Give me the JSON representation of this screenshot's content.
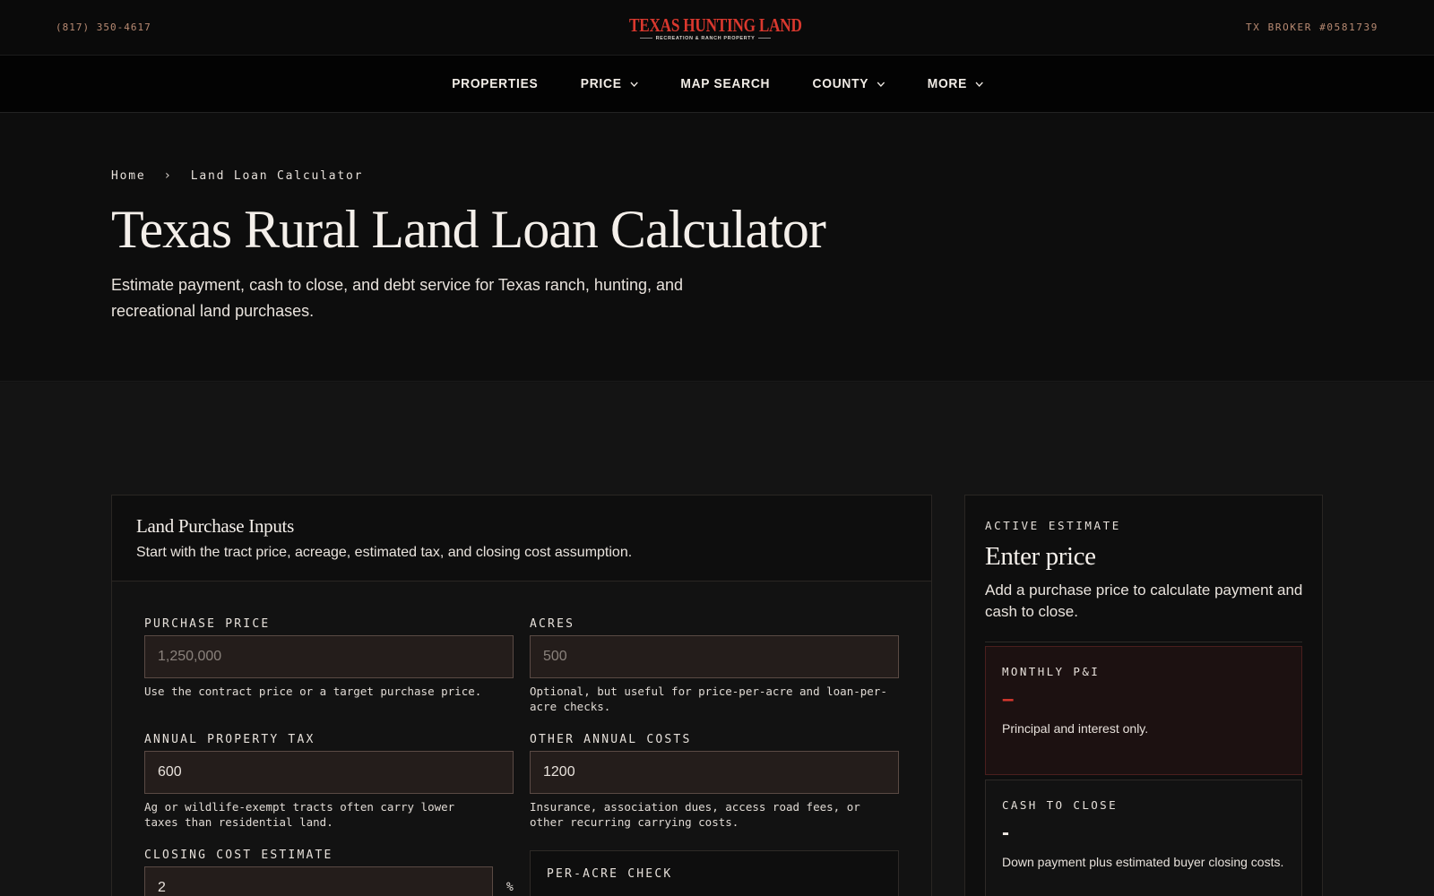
{
  "header": {
    "phone": "(817) 350-4617",
    "broker": "TX BROKER #0581739",
    "logo_name": "TEXAS HUNTING LAND",
    "logo_tagline": "RECREATION & RANCH PROPERTY"
  },
  "nav": {
    "items": [
      {
        "label": "PROPERTIES",
        "dropdown": false
      },
      {
        "label": "PRICE",
        "dropdown": true
      },
      {
        "label": "MAP SEARCH",
        "dropdown": false
      },
      {
        "label": "COUNTY",
        "dropdown": true
      },
      {
        "label": "MORE",
        "dropdown": true
      }
    ]
  },
  "breadcrumb": {
    "home": "Home",
    "separator": "›",
    "current": "Land Loan Calculator"
  },
  "hero": {
    "title": "Texas Rural Land Loan Calculator",
    "subtitle": "Estimate payment, cash to close, and debt service for Texas ranch, hunting, and recreational land purchases."
  },
  "inputs": {
    "title": "Land Purchase Inputs",
    "description": "Start with the tract price, acreage, estimated tax, and closing cost assumption.",
    "purchase_price": {
      "label": "PURCHASE PRICE",
      "value": "",
      "placeholder": "1,250,000",
      "help": "Use the contract price or a target purchase price."
    },
    "acres": {
      "label": "ACRES",
      "value": "",
      "placeholder": "500",
      "help": "Optional, but useful for price-per-acre and loan-per-acre checks."
    },
    "annual_tax": {
      "label": "ANNUAL PROPERTY TAX",
      "value": "600",
      "placeholder": "",
      "help": "Ag or wildlife-exempt tracts often carry lower taxes than residential land."
    },
    "other_costs": {
      "label": "OTHER ANNUAL COSTS",
      "value": "1200",
      "placeholder": "",
      "help": "Insurance, association dues, access road fees, or other recurring carrying costs."
    },
    "closing_cost": {
      "label": "CLOSING COST ESTIMATE",
      "value": "2",
      "placeholder": "",
      "unit": "%"
    },
    "per_acre_check": {
      "label": "PER-ACRE CHECK"
    }
  },
  "estimate": {
    "kicker": "ACTIVE ESTIMATE",
    "title": "Enter price",
    "description": "Add a purchase price to calculate payment and cash to close.",
    "monthly": {
      "label": "MONTHLY P&I",
      "value": "–",
      "note": "Principal and interest only."
    },
    "cash_to_close": {
      "label": "CASH TO CLOSE",
      "value": "-",
      "note": "Down payment plus estimated buyer closing costs."
    }
  },
  "colors": {
    "accent_red": "#d9382e",
    "background": "#111111",
    "input_bg": "#241d1b",
    "muted_copper": "#b88a72"
  }
}
